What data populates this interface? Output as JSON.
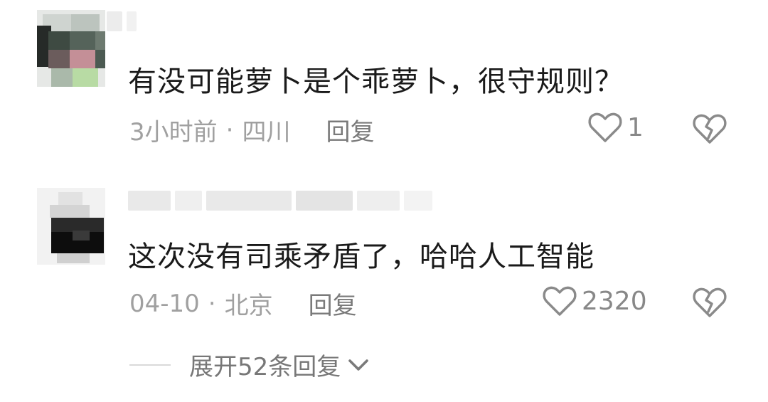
{
  "comments": [
    {
      "text": "有没可能萝卜是个乖萝卜，很守规则？",
      "time": "3小时前",
      "separator": "·",
      "location": "四川",
      "reply_label": "回复",
      "like_count": "1",
      "icons": {
        "like": "heart-outline-icon",
        "dislike": "broken-heart-icon"
      }
    },
    {
      "text": "这次没有司乘矛盾了，哈哈人工智能",
      "time": "04-10",
      "separator": "·",
      "location": "北京",
      "reply_label": "回复",
      "like_count": "2320",
      "icons": {
        "like": "heart-outline-icon",
        "dislike": "broken-heart-icon"
      }
    }
  ],
  "expand_replies": {
    "label": "展开52条回复",
    "icon": "chevron-down-icon"
  },
  "colors": {
    "text_primary": "#1a1a1a",
    "text_secondary": "#a0a0a0",
    "icon_gray": "#888888"
  }
}
